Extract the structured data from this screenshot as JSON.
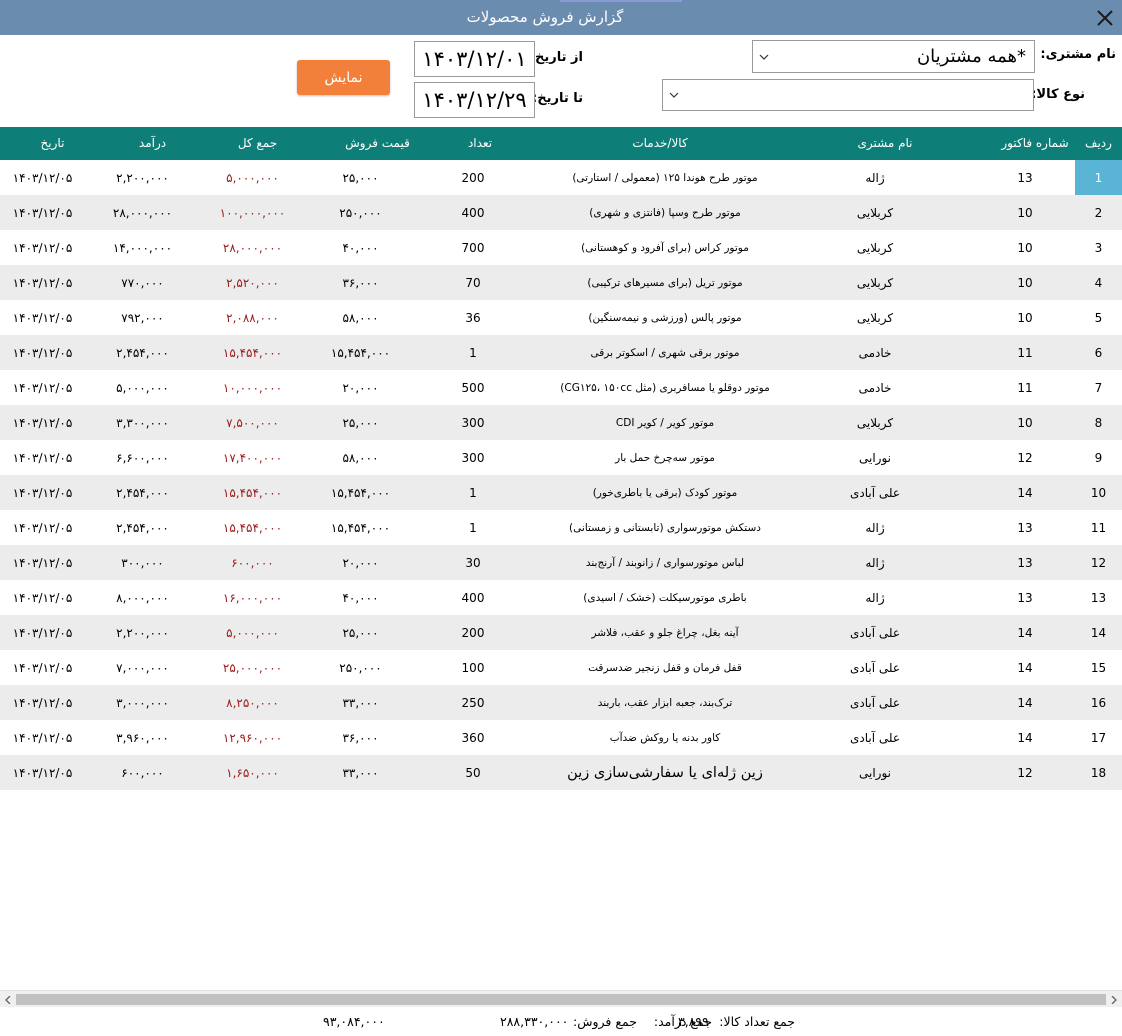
{
  "window": {
    "title": "گزارش فروش محصولات",
    "close_icon": "close-icon"
  },
  "filters": {
    "customer_label": "نام مشتری:",
    "customer_value": "*همه مشتریان",
    "product_type_label": "نوع کالا:",
    "product_type_value": "",
    "from_label": "از تاریخ:",
    "from_value": "۱۴۰۳/۱۲/۰۱",
    "to_label": "تا تاریخ:",
    "to_value": "۱۴۰۳/۱۲/۲۹",
    "show_button": "نمایش"
  },
  "colors": {
    "header_bg": "#0e7f78",
    "title_bg": "#6a8caf",
    "button": "#f2803a",
    "total_red": "#9b1c1c",
    "selected": "#5ab4d6"
  },
  "columns": {
    "row": "ردیف",
    "invoice": "شماره فاکتور",
    "customer": "نام مشتری",
    "product": "کالا/خدمات",
    "qty": "تعداد",
    "price": "قیمت فروش",
    "total": "جمع کل",
    "income": "درآمد",
    "date": "تاریخ"
  },
  "rows": [
    {
      "row": "1",
      "invoice": "13",
      "customer": "ژاله",
      "product": "موتور طرح هوندا ۱۲۵ (معمولی / استارتی)",
      "qty": "200",
      "price": "۲۵,۰۰۰",
      "total": "۵,۰۰۰,۰۰۰",
      "income": "۲,۲۰۰,۰۰۰",
      "date": "۱۴۰۳/۱۲/۰۵"
    },
    {
      "row": "2",
      "invoice": "10",
      "customer": "کربلایی",
      "product": "موتور طرح وسپا (فانتزی و شهری)",
      "qty": "400",
      "price": "۲۵۰,۰۰۰",
      "total": "۱۰۰,۰۰۰,۰۰۰",
      "income": "۲۸,۰۰۰,۰۰۰",
      "date": "۱۴۰۳/۱۲/۰۵"
    },
    {
      "row": "3",
      "invoice": "10",
      "customer": "کربلایی",
      "product": "موتور کراس (برای آفرود و کوهستانی)",
      "qty": "700",
      "price": "۴۰,۰۰۰",
      "total": "۲۸,۰۰۰,۰۰۰",
      "income": "۱۴,۰۰۰,۰۰۰",
      "date": "۱۴۰۳/۱۲/۰۵"
    },
    {
      "row": "4",
      "invoice": "10",
      "customer": "کربلایی",
      "product": "موتور تریل (برای مسیرهای ترکیبی)",
      "qty": "70",
      "price": "۳۶,۰۰۰",
      "total": "۲,۵۲۰,۰۰۰",
      "income": "۷۷۰,۰۰۰",
      "date": "۱۴۰۳/۱۲/۰۵"
    },
    {
      "row": "5",
      "invoice": "10",
      "customer": "کربلایی",
      "product": "موتور پالس (ورزشی و نیمه‌سنگین)",
      "qty": "36",
      "price": "۵۸,۰۰۰",
      "total": "۲,۰۸۸,۰۰۰",
      "income": "۷۹۲,۰۰۰",
      "date": "۱۴۰۳/۱۲/۰۵"
    },
    {
      "row": "6",
      "invoice": "11",
      "customer": "خادمی",
      "product": "موتور برقی شهری / اسکوتر برقی",
      "qty": "1",
      "price": "۱۵,۴۵۴,۰۰۰",
      "total": "۱۵,۴۵۴,۰۰۰",
      "income": "۲,۴۵۴,۰۰۰",
      "date": "۱۴۰۳/۱۲/۰۵"
    },
    {
      "row": "7",
      "invoice": "11",
      "customer": "خادمی",
      "product": "موتور دوقلو یا مسافربری (مثل CG۱۲۵، ۱۵۰cc)",
      "qty": "500",
      "price": "۲۰,۰۰۰",
      "total": "۱۰,۰۰۰,۰۰۰",
      "income": "۵,۰۰۰,۰۰۰",
      "date": "۱۴۰۳/۱۲/۰۵"
    },
    {
      "row": "8",
      "invoice": "10",
      "customer": "کربلایی",
      "product": "موتور کویر / کویر CDI",
      "qty": "300",
      "price": "۲۵,۰۰۰",
      "total": "۷,۵۰۰,۰۰۰",
      "income": "۳,۳۰۰,۰۰۰",
      "date": "۱۴۰۳/۱۲/۰۵"
    },
    {
      "row": "9",
      "invoice": "12",
      "customer": "نورایی",
      "product": "موتور سه‌چرخ حمل بار",
      "qty": "300",
      "price": "۵۸,۰۰۰",
      "total": "۱۷,۴۰۰,۰۰۰",
      "income": "۶,۶۰۰,۰۰۰",
      "date": "۱۴۰۳/۱۲/۰۵"
    },
    {
      "row": "10",
      "invoice": "14",
      "customer": "علی آبادی",
      "product": "موتور کودک (برقی یا باطری‌خور)",
      "qty": "1",
      "price": "۱۵,۴۵۴,۰۰۰",
      "total": "۱۵,۴۵۴,۰۰۰",
      "income": "۲,۴۵۴,۰۰۰",
      "date": "۱۴۰۳/۱۲/۰۵"
    },
    {
      "row": "11",
      "invoice": "13",
      "customer": "ژاله",
      "product": "دستکش موتورسواری (تابستانی و زمستانی)",
      "qty": "1",
      "price": "۱۵,۴۵۴,۰۰۰",
      "total": "۱۵,۴۵۴,۰۰۰",
      "income": "۲,۴۵۴,۰۰۰",
      "date": "۱۴۰۳/۱۲/۰۵"
    },
    {
      "row": "12",
      "invoice": "13",
      "customer": "ژاله",
      "product": "لباس موتورسواری / زانوبند / آرنج‌بند",
      "qty": "30",
      "price": "۲۰,۰۰۰",
      "total": "۶۰۰,۰۰۰",
      "income": "۳۰۰,۰۰۰",
      "date": "۱۴۰۳/۱۲/۰۵"
    },
    {
      "row": "13",
      "invoice": "13",
      "customer": "ژاله",
      "product": "باطری موتورسیکلت (خشک / اسیدی)",
      "qty": "400",
      "price": "۴۰,۰۰۰",
      "total": "۱۶,۰۰۰,۰۰۰",
      "income": "۸,۰۰۰,۰۰۰",
      "date": "۱۴۰۳/۱۲/۰۵"
    },
    {
      "row": "14",
      "invoice": "14",
      "customer": "علی آبادی",
      "product": "آینه بغل، چراغ جلو و عقب، فلاشر",
      "qty": "200",
      "price": "۲۵,۰۰۰",
      "total": "۵,۰۰۰,۰۰۰",
      "income": "۲,۲۰۰,۰۰۰",
      "date": "۱۴۰۳/۱۲/۰۵"
    },
    {
      "row": "15",
      "invoice": "14",
      "customer": "علی آبادی",
      "product": "قفل فرمان و قفل زنجیر ضدسرقت",
      "qty": "100",
      "price": "۲۵۰,۰۰۰",
      "total": "۲۵,۰۰۰,۰۰۰",
      "income": "۷,۰۰۰,۰۰۰",
      "date": "۱۴۰۳/۱۲/۰۵"
    },
    {
      "row": "16",
      "invoice": "14",
      "customer": "علی آبادی",
      "product": "ترک‌بند، جعبه ابزار عقب، باربند",
      "qty": "250",
      "price": "۳۳,۰۰۰",
      "total": "۸,۲۵۰,۰۰۰",
      "income": "۳,۰۰۰,۰۰۰",
      "date": "۱۴۰۳/۱۲/۰۵"
    },
    {
      "row": "17",
      "invoice": "14",
      "customer": "علی آبادی",
      "product": "کاور بدنه یا روکش ضدآب",
      "qty": "360",
      "price": "۳۶,۰۰۰",
      "total": "۱۲,۹۶۰,۰۰۰",
      "income": "۳,۹۶۰,۰۰۰",
      "date": "۱۴۰۳/۱۲/۰۵"
    },
    {
      "row": "18",
      "invoice": "12",
      "customer": "نورایی",
      "product": "زین ژله‌ای یا سفارشی‌سازی زین",
      "qty": "50",
      "price": "۳۳,۰۰۰",
      "total": "۱,۶۵۰,۰۰۰",
      "income": "۶۰۰,۰۰۰",
      "date": "۱۴۰۳/۱۲/۰۵"
    }
  ],
  "footer": {
    "qty_label": "جمع تعداد کالا:",
    "qty_value": "۳,۸۹۹",
    "sales_label": "جمع فروش:",
    "sales_value": "۲۸۸,۳۳۰,۰۰۰",
    "income_label": "جمع درآمد:",
    "income_value": "۹۳,۰۸۴,۰۰۰"
  }
}
